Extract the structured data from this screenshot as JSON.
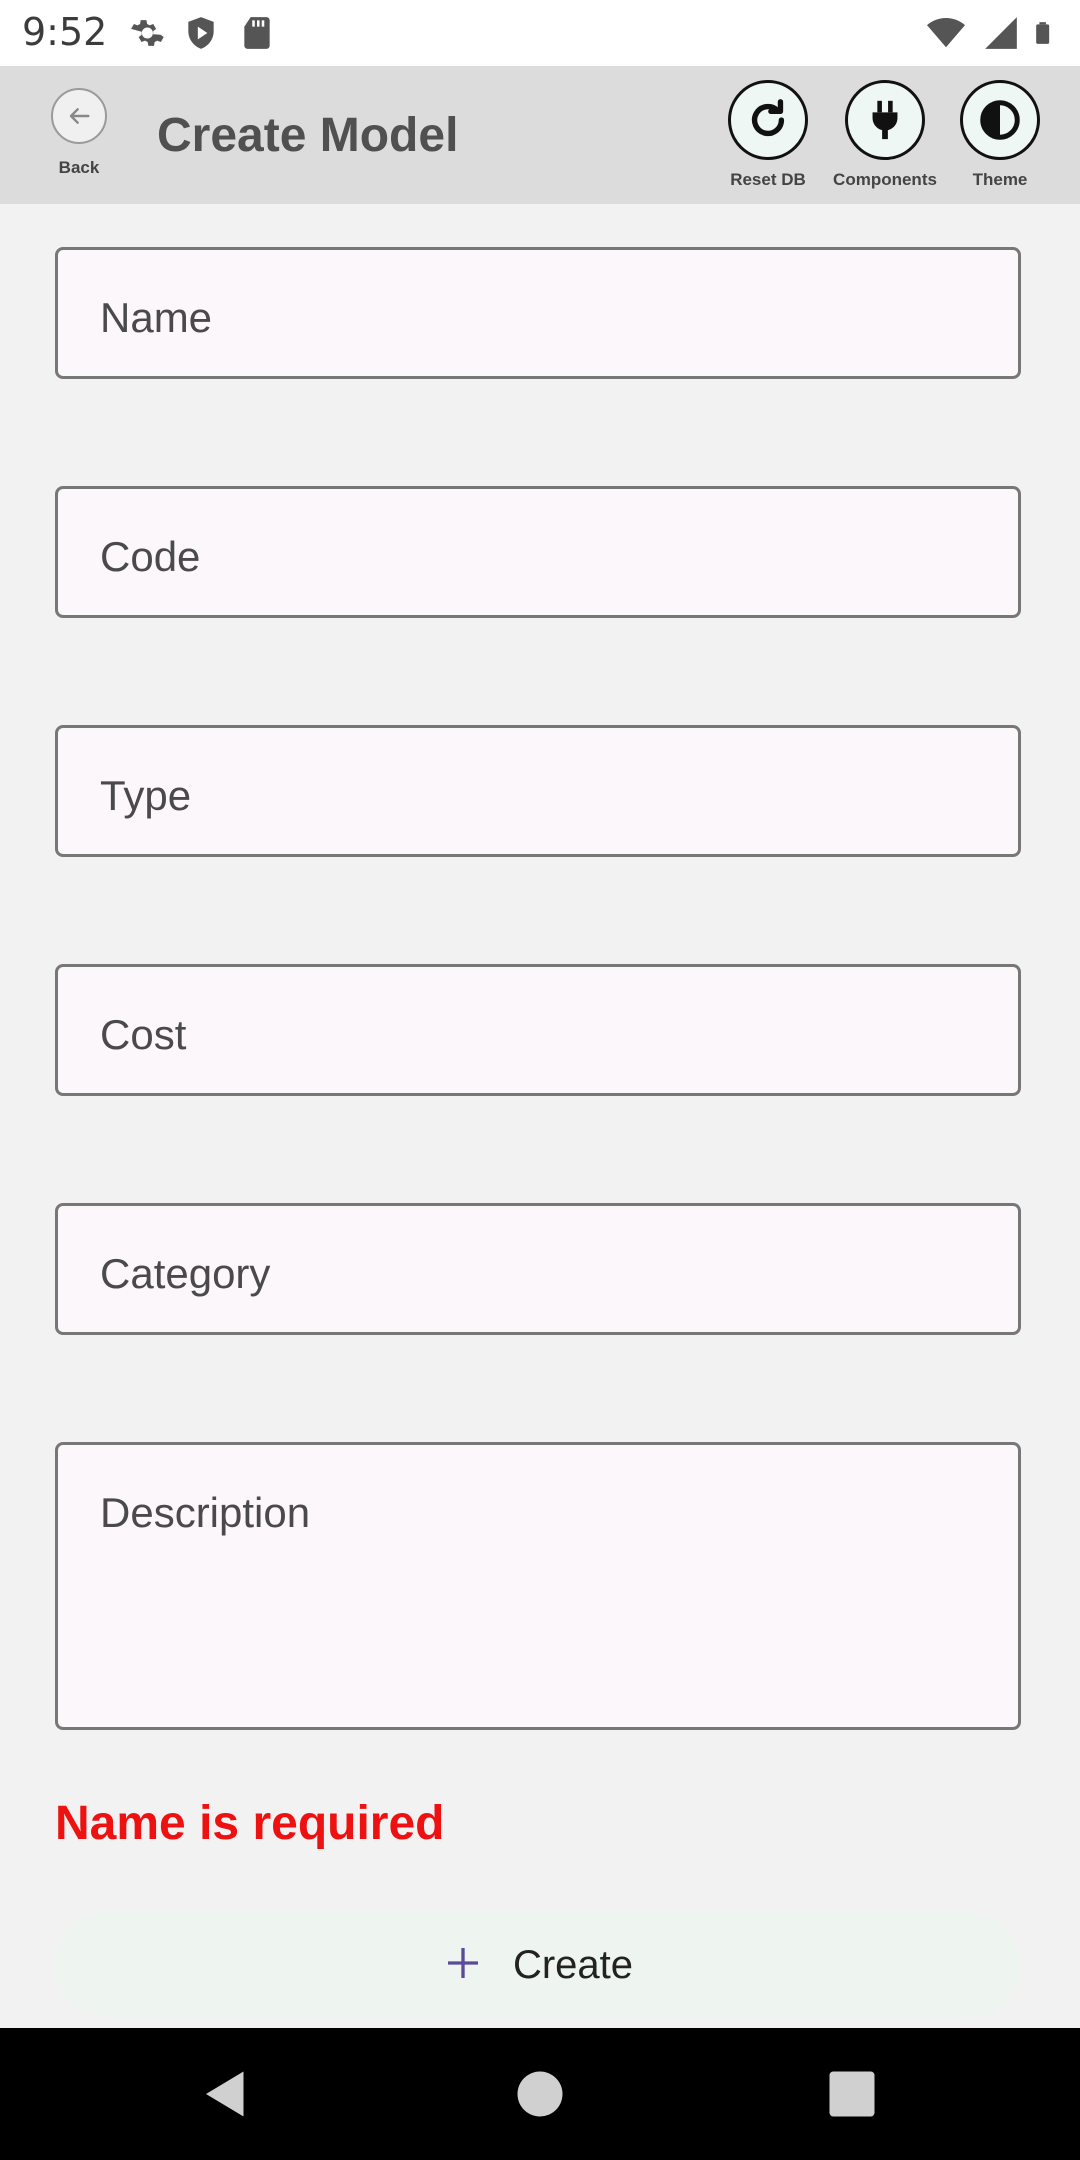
{
  "status_bar": {
    "time": "9:52",
    "left_icons": [
      "settings-gear-icon",
      "shield-icon",
      "sd-card-icon"
    ],
    "right_icons": [
      "wifi-icon",
      "signal-icon",
      "battery-icon"
    ]
  },
  "app_bar": {
    "back_label": "Back",
    "title": "Create Model",
    "actions": [
      {
        "label": "Reset DB",
        "icon": "refresh-icon"
      },
      {
        "label": "Components",
        "icon": "plug-icon"
      },
      {
        "label": "Theme",
        "icon": "theme-contrast-icon"
      }
    ]
  },
  "form": {
    "fields": [
      {
        "label": "Name",
        "value": ""
      },
      {
        "label": "Code",
        "value": ""
      },
      {
        "label": "Type",
        "value": ""
      },
      {
        "label": "Cost",
        "value": ""
      },
      {
        "label": "Category",
        "value": ""
      },
      {
        "label": "Description",
        "value": ""
      }
    ],
    "error": "Name is required",
    "create_label": "Create",
    "create_icon": "plus-icon"
  },
  "colors": {
    "error": "#ee1111",
    "accent": "#5b4a9c",
    "app_bar": "#dcdcdc",
    "field_bg": "#fcf7fb"
  },
  "nav_bar": {
    "buttons": [
      "back-triangle-icon",
      "home-circle-icon",
      "recents-square-icon"
    ]
  }
}
